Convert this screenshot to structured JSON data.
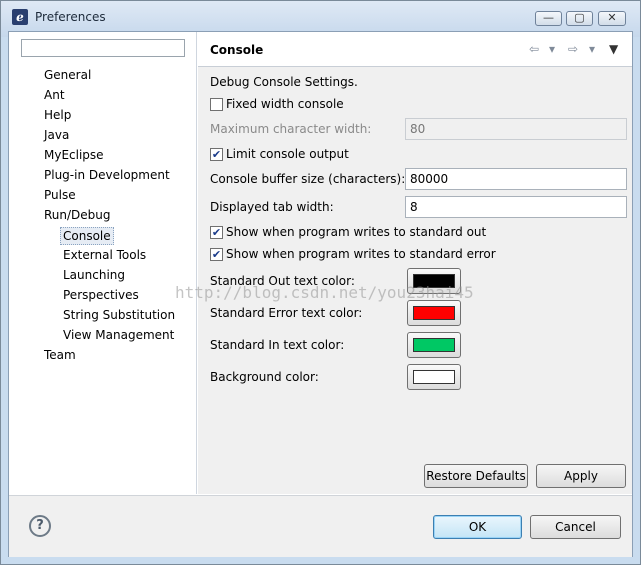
{
  "window": {
    "title": "Preferences",
    "app_icon": "eclipse-icon",
    "minimize_glyph": "—",
    "maximize_glyph": "▢",
    "close_glyph": "✕"
  },
  "filter": {
    "value": "",
    "placeholder": ""
  },
  "tree": {
    "items": [
      {
        "label": "General"
      },
      {
        "label": "Ant"
      },
      {
        "label": "Help"
      },
      {
        "label": "Java"
      },
      {
        "label": "MyEclipse"
      },
      {
        "label": "Plug-in Development"
      },
      {
        "label": "Pulse"
      },
      {
        "label": "Run/Debug"
      },
      {
        "label": "Console",
        "selected": true
      },
      {
        "label": "External Tools"
      },
      {
        "label": "Launching"
      },
      {
        "label": "Perspectives"
      },
      {
        "label": "String Substitution"
      },
      {
        "label": "View Management"
      },
      {
        "label": "Team"
      }
    ]
  },
  "page": {
    "title": "Console",
    "nav": {
      "back": "⇦",
      "back_menu": "▾",
      "forward": "⇨",
      "forward_menu": "▾",
      "view_menu": "▼"
    },
    "section_label": "Debug Console Settings.",
    "fixed_width": {
      "label": "Fixed width console",
      "checked": false
    },
    "max_char_width": {
      "label": "Maximum character width:",
      "value": "80"
    },
    "limit_output": {
      "label": "Limit console output",
      "checked": true
    },
    "buffer_size": {
      "label": "Console buffer size (characters):",
      "value": "80000"
    },
    "tab_width": {
      "label": "Displayed tab width:",
      "value": "8"
    },
    "show_out": {
      "label": "Show when program writes to standard out",
      "checked": true
    },
    "show_err": {
      "label": "Show when program writes to standard error",
      "checked": true
    },
    "colors": [
      {
        "label": "Standard Out text color:",
        "color": "#000000"
      },
      {
        "label": "Standard Error text color:",
        "color": "#ff0000"
      },
      {
        "label": "Standard In text color:",
        "color": "#00c864"
      },
      {
        "label": "Background color:",
        "color": "#ffffff"
      }
    ],
    "restore_defaults_label": "Restore Defaults",
    "apply_label": "Apply"
  },
  "footer": {
    "help_glyph": "?",
    "ok_label": "OK",
    "cancel_label": "Cancel"
  },
  "watermark": "http://blog.csdn.net/you23hai45",
  "checkmark": "✔"
}
